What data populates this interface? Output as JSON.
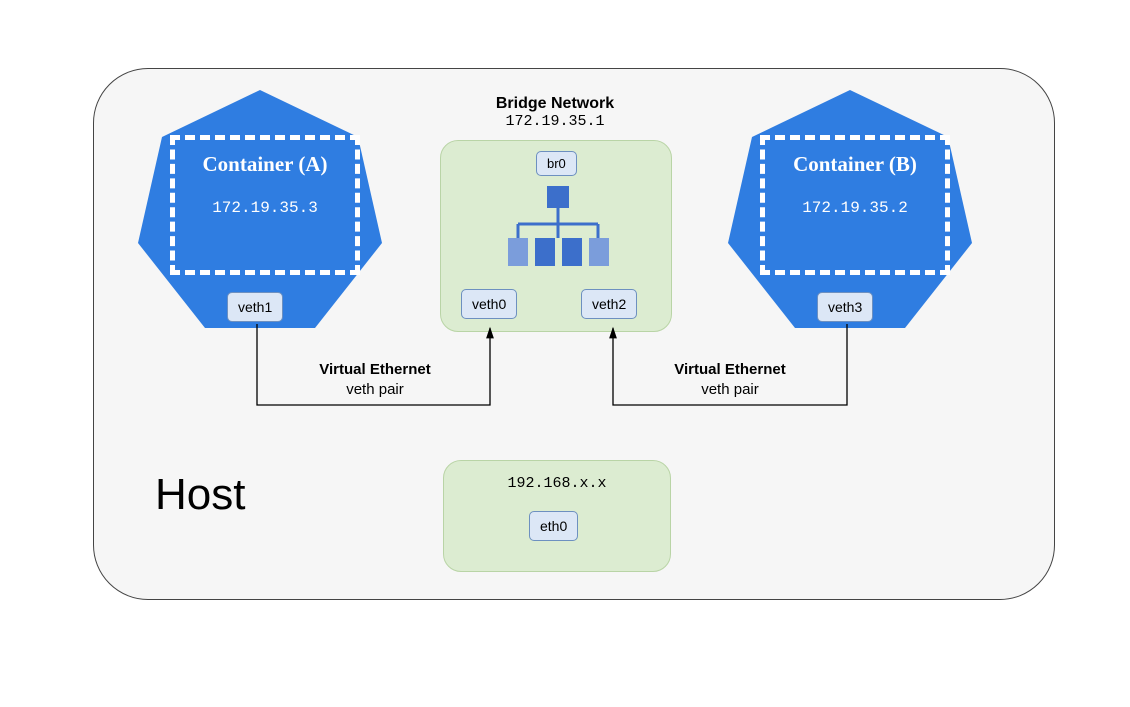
{
  "host": {
    "label": "Host"
  },
  "bridge": {
    "title": "Bridge Network",
    "ip": "172.19.35.1",
    "br_if": "br0",
    "left_if": "veth0",
    "right_if": "veth2"
  },
  "container_a": {
    "name": "Container (A)",
    "ip": "172.19.35.3",
    "veth": "veth1"
  },
  "container_b": {
    "name": "Container (B)",
    "ip": "172.19.35.2",
    "veth": "veth3"
  },
  "veth_pair": {
    "title": "Virtual Ethernet",
    "sub": "veth pair"
  },
  "host_nic": {
    "ip": "192.168.x.x",
    "if": "eth0"
  }
}
